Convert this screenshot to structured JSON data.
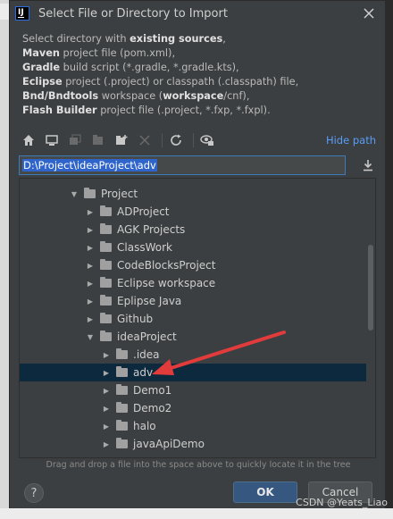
{
  "window": {
    "title": "Select File or Directory to Import",
    "icon": "intellij-icon"
  },
  "info": {
    "lines": [
      {
        "pre": "Select directory with ",
        "bold": "existing sources",
        "post": ","
      },
      {
        "pre": "",
        "bold": "Maven",
        "post": " project file (pom.xml),"
      },
      {
        "pre": "",
        "bold": "Gradle",
        "post": " build script (*.gradle, *.gradle.kts),"
      },
      {
        "pre": "",
        "bold": "Eclipse",
        "post": " project (.project) or classpath (.classpath) file,"
      },
      {
        "pre": "",
        "bold": "Bnd/Bndtools",
        "post": " workspace (",
        "bold2": "workspace",
        "post2": "/cnf),"
      },
      {
        "pre": "",
        "bold": "Flash Builder",
        "post": " project file (.project, *.fxp, *.fxpl)."
      }
    ]
  },
  "toolbar": {
    "icons": [
      "home-icon",
      "desktop-icon",
      "project-icon",
      "module-icon",
      "new-folder-icon",
      "delete-icon",
      "refresh-icon",
      "show-hidden-icon"
    ],
    "hide_path_label": "Hide path"
  },
  "path": {
    "value": "D:\\Project\\ideaProject\\adv"
  },
  "tree": {
    "items": [
      {
        "label": "Project",
        "expanded": true
      },
      {
        "label": "ADProject",
        "expanded": false
      },
      {
        "label": "AGK Projects",
        "expanded": false
      },
      {
        "label": "ClassWork",
        "expanded": false
      },
      {
        "label": "CodeBlocksProject",
        "expanded": false
      },
      {
        "label": "Eclipse workspace",
        "expanded": false
      },
      {
        "label": "Eplipse Java",
        "expanded": false
      },
      {
        "label": "Github",
        "expanded": false
      },
      {
        "label": "ideaProject",
        "expanded": true
      },
      {
        "label": ".idea",
        "expanded": false
      },
      {
        "label": "adv",
        "expanded": false,
        "selected": true
      },
      {
        "label": "Demo1",
        "expanded": false
      },
      {
        "label": "Demo2",
        "expanded": false
      },
      {
        "label": "halo",
        "expanded": false
      },
      {
        "label": "javaApiDemo",
        "expanded": false
      }
    ]
  },
  "hint": "Drag and drop a file into the space above to quickly locate it in the tree",
  "buttons": {
    "help": "?",
    "ok": "OK",
    "cancel": "Cancel"
  },
  "watermark": "CSDN @Yeats_Liao",
  "colors": {
    "accent": "#589df6",
    "selection": "#0d293e",
    "annotation_arrow": "#e23b3b"
  }
}
